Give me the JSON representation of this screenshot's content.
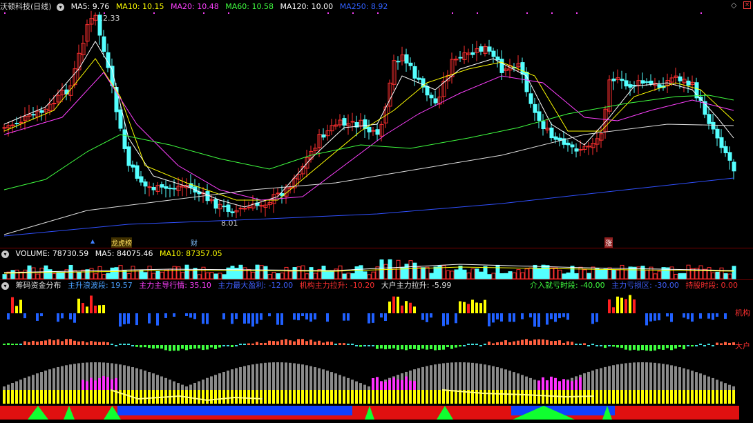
{
  "main_header": {
    "title": "沃顿科技(日线)",
    "indicators": [
      {
        "label": "MA5: 9.76",
        "color": "#ffffff"
      },
      {
        "label": "MA10: 10.15",
        "color": "#ffff00"
      },
      {
        "label": "MA20: 10.48",
        "color": "#ff40ff"
      },
      {
        "label": "MA60: 10.58",
        "color": "#40ff40"
      },
      {
        "label": "MA120: 10.00",
        "color": "#ffffff"
      },
      {
        "label": "MA250: 8.92",
        "color": "#3060ff"
      }
    ]
  },
  "annotations": {
    "high_price": "12.33",
    "low_price": "8.01",
    "markers": [
      {
        "label": "龙虎榜",
        "kind": "ranking"
      },
      {
        "label": "财",
        "kind": "finance"
      },
      {
        "label": "涨",
        "kind": "limit-up"
      }
    ]
  },
  "volume_header": {
    "items": [
      {
        "label": "VOLUME: 78730.59",
        "color": "#ffffff"
      },
      {
        "label": "MA5: 84075.46",
        "color": "#ffffff"
      },
      {
        "label": "MA10: 87357.05",
        "color": "#ffff00"
      }
    ]
  },
  "chip_header": {
    "title": "筹码资金分布",
    "items": [
      {
        "label": "主升浪波段: 19.57",
        "color": "#4aa0ff"
      },
      {
        "label": "主力主导行情: 35.10",
        "color": "#ff40ff"
      },
      {
        "label": "主力最大盈利: -12.00",
        "color": "#4060ff"
      },
      {
        "label": "机构主力拉升: -10.20",
        "color": "#ff3030"
      },
      {
        "label": "大户主力拉升: -5.99",
        "color": "#e0e0e0"
      }
    ],
    "right_items": [
      {
        "label": "介入就亏时段: -40.00",
        "color": "#40ff40"
      },
      {
        "label": "主力亏损区: -30.00",
        "color": "#4060ff"
      },
      {
        "label": "持股时段: 0.00",
        "color": "#ff3030"
      }
    ]
  },
  "side_labels": {
    "institution": "机构",
    "big_holder": "大户"
  },
  "colors": {
    "up": "#ff3030",
    "down": "#54ffff",
    "ma5": "#ffffff",
    "ma10": "#ffff00",
    "ma20": "#ff40ff",
    "ma60": "#40ff40",
    "ma120": "#e0e0e0",
    "ma250": "#3050ff"
  }
}
